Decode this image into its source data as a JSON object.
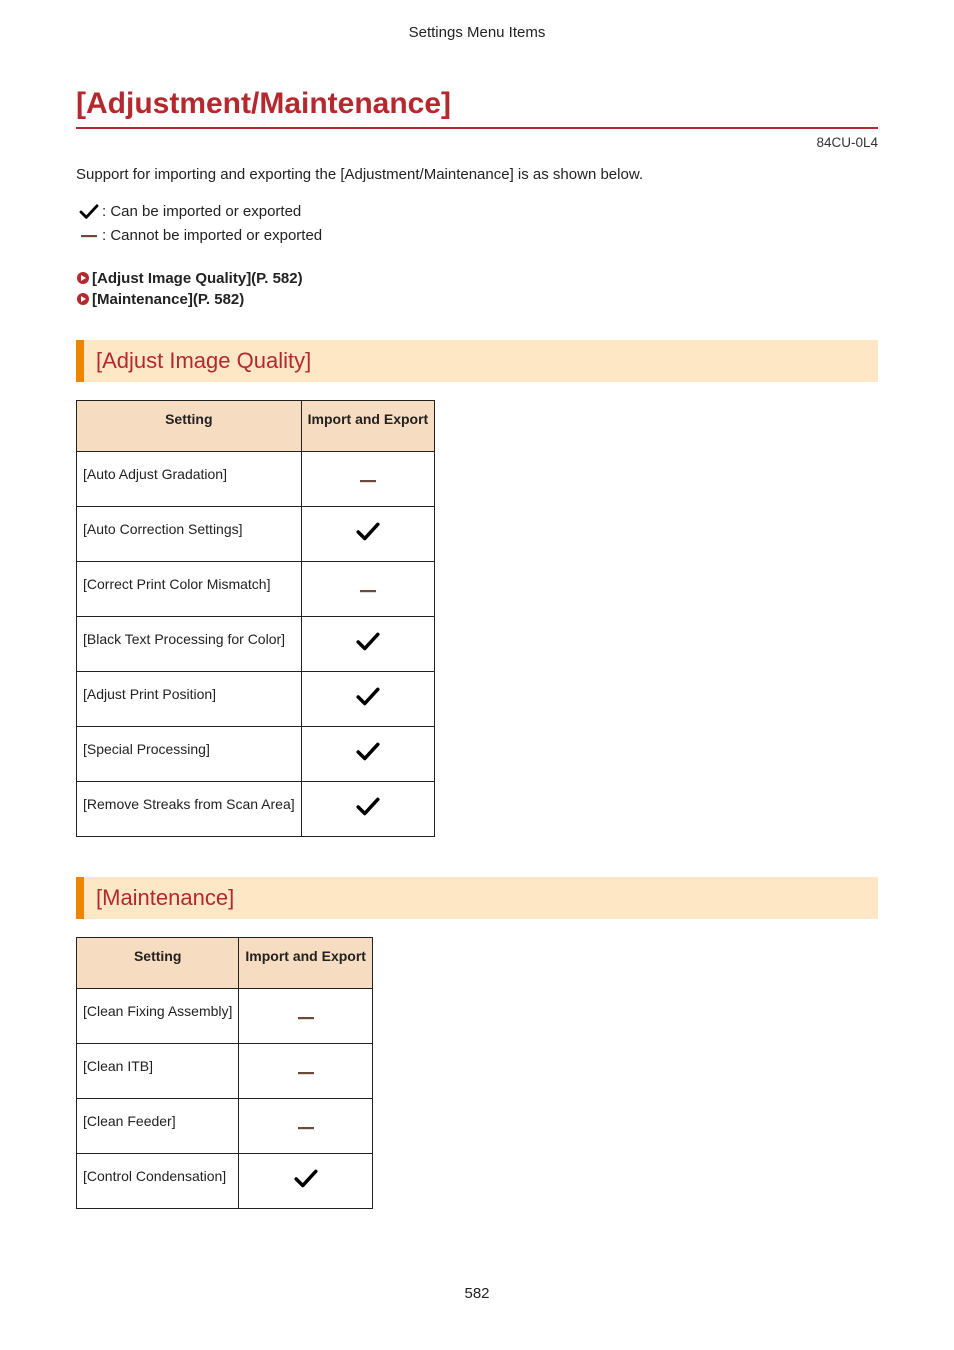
{
  "header": "Settings Menu Items",
  "title": "[Adjustment/Maintenance]",
  "doc_id": "84CU-0L4",
  "intro": "Support for importing and exporting the [Adjustment/Maintenance] is as shown below.",
  "legend": {
    "can": ": Can be imported or exported",
    "cannot": ": Cannot be imported or exported"
  },
  "links": [
    {
      "text": "[Adjust Image Quality](P. 582)"
    },
    {
      "text": "[Maintenance](P. 582)"
    }
  ],
  "table_headers": {
    "setting": "Setting",
    "export": "Import and Export"
  },
  "sections": [
    {
      "heading": "[Adjust Image Quality]",
      "rows": [
        {
          "label": "[Auto Adjust Gradation]",
          "mark": "dash"
        },
        {
          "label": "[Auto Correction Settings]",
          "mark": "check"
        },
        {
          "label": "[Correct Print Color Mismatch]",
          "mark": "dash"
        },
        {
          "label": "[Black Text Processing for Color]",
          "mark": "check"
        },
        {
          "label": "[Adjust Print Position]",
          "mark": "check"
        },
        {
          "label": "[Special Processing]",
          "mark": "check"
        },
        {
          "label": "[Remove Streaks from Scan Area]",
          "mark": "check"
        }
      ]
    },
    {
      "heading": "[Maintenance]",
      "rows": [
        {
          "label": "[Clean Fixing Assembly]",
          "mark": "dash"
        },
        {
          "label": "[Clean ITB]",
          "mark": "dash"
        },
        {
          "label": "[Clean Feeder]",
          "mark": "dash"
        },
        {
          "label": "[Control Condensation]",
          "mark": "check"
        }
      ]
    }
  ],
  "page_number": "582"
}
